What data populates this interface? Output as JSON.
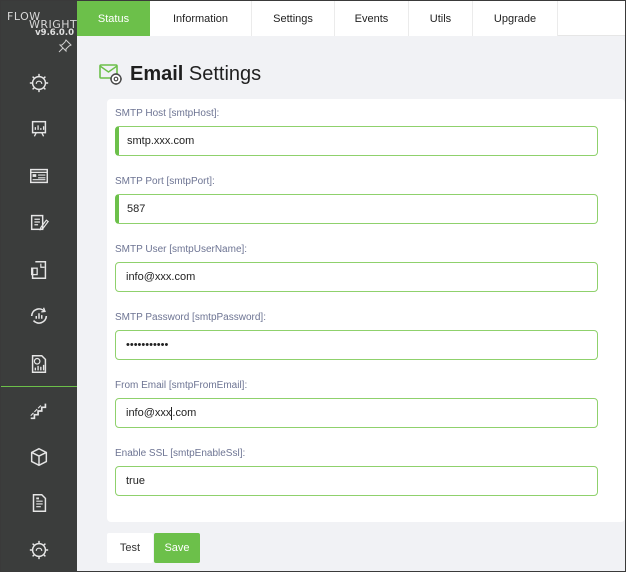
{
  "brand": {
    "logo_line1": "FLOW",
    "logo_line2": "WRIGHT",
    "version": "v9.6.0.0",
    "accent_color": "#6cc04a",
    "sidebar_color": "#3b3d3c"
  },
  "sidebar": {
    "items": [
      {
        "icon": "gear-brain-icon"
      },
      {
        "icon": "monitor-chart-icon"
      },
      {
        "icon": "dashboard-list-icon"
      },
      {
        "icon": "clipboard-edit-icon"
      },
      {
        "icon": "document-corner-icon"
      },
      {
        "icon": "cycle-chart-icon"
      },
      {
        "icon": "report-chart-icon"
      },
      {
        "icon": "stairs-icon"
      },
      {
        "icon": "cube-icon"
      },
      {
        "icon": "document-list-icon"
      },
      {
        "icon": "gear-brain-icon"
      }
    ]
  },
  "tabs": [
    {
      "label": "Status",
      "active": true
    },
    {
      "label": "Information",
      "active": false
    },
    {
      "label": "Settings",
      "active": false
    },
    {
      "label": "Events",
      "active": false
    },
    {
      "label": "Utils",
      "active": false
    },
    {
      "label": "Upgrade",
      "active": false
    }
  ],
  "page": {
    "title_bold": "Email",
    "title_rest": " Settings"
  },
  "form": {
    "fields": [
      {
        "label": "SMTP Host [smtpHost]:",
        "value": "smtp.xxx.com"
      },
      {
        "label": "SMTP Port [smtpPort]:",
        "value": "587"
      },
      {
        "label": "SMTP User [smtpUserName]:",
        "value": "info@xxx.com"
      },
      {
        "label": "SMTP Password [smtpPassword]:",
        "value": "•••••••••••"
      },
      {
        "label": "From Email [smtpFromEmail]:",
        "value_before_caret": "info@xxx",
        "value_after_caret": ".com"
      },
      {
        "label": "Enable SSL [smtpEnableSsl]:",
        "value": "true"
      }
    ]
  },
  "buttons": {
    "test_label": "Test",
    "save_label": "Save"
  }
}
